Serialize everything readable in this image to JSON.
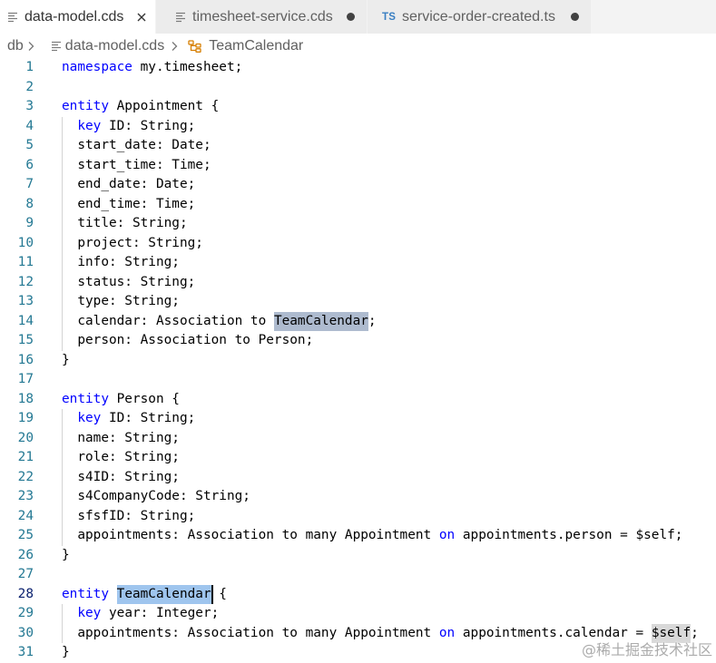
{
  "tabs": [
    {
      "label": "data-model.cds",
      "icon": "cds-file-icon",
      "active": true,
      "action_icon": "close-icon"
    },
    {
      "label": "timesheet-service.cds",
      "icon": "cds-file-icon",
      "modified": true,
      "action_icon": "modified-dot-icon"
    },
    {
      "label": "service-order-created.ts",
      "icon": "typescript-file-icon",
      "badge": "TS",
      "modified": true,
      "action_icon": "modified-dot-icon"
    }
  ],
  "breadcrumb": [
    {
      "label": "db"
    },
    {
      "label": "data-model.cds",
      "icon": "cds-file-icon"
    },
    {
      "label": "TeamCalendar",
      "icon": "symbol-class-icon"
    }
  ],
  "breadcrumb_separator_icon": "chevron-right-icon",
  "colors": {
    "keyword": "#0000ff",
    "text": "#000000",
    "line_number": "#237893",
    "active_line_number": "#0b216f",
    "selection": "#9fc5ee",
    "word_highlight": "#aebbcf",
    "match_highlight": "#d9d9d9",
    "ts_badge": "#3a7fc2",
    "symbol_icon": "#d67e00"
  },
  "editor": {
    "active_line": "28",
    "lines": [
      {
        "n": "1",
        "tokens": [
          {
            "text": "namespace",
            "type": "keyword"
          },
          {
            "text": " my.timesheet;"
          }
        ]
      },
      {
        "n": "2",
        "tokens": []
      },
      {
        "n": "3",
        "tokens": [
          {
            "text": "entity",
            "type": "keyword"
          },
          {
            "text": " Appointment {"
          }
        ]
      },
      {
        "n": "4",
        "tokens": [
          {
            "text": "  ",
            "type": "indent"
          },
          {
            "text": "key",
            "type": "keyword"
          },
          {
            "text": " ID: String;"
          }
        ]
      },
      {
        "n": "5",
        "tokens": [
          {
            "text": "  ",
            "type": "indent"
          },
          {
            "text": "start_date: Date;"
          }
        ]
      },
      {
        "n": "6",
        "tokens": [
          {
            "text": "  ",
            "type": "indent"
          },
          {
            "text": "start_time: Time;"
          }
        ]
      },
      {
        "n": "7",
        "tokens": [
          {
            "text": "  ",
            "type": "indent"
          },
          {
            "text": "end_date: Date;"
          }
        ]
      },
      {
        "n": "8",
        "tokens": [
          {
            "text": "  ",
            "type": "indent"
          },
          {
            "text": "end_time: Time;"
          }
        ]
      },
      {
        "n": "9",
        "tokens": [
          {
            "text": "  ",
            "type": "indent"
          },
          {
            "text": "title: String;"
          }
        ]
      },
      {
        "n": "10",
        "tokens": [
          {
            "text": "  ",
            "type": "indent"
          },
          {
            "text": "project: String;"
          }
        ]
      },
      {
        "n": "11",
        "tokens": [
          {
            "text": "  ",
            "type": "indent"
          },
          {
            "text": "info: String;"
          }
        ]
      },
      {
        "n": "12",
        "tokens": [
          {
            "text": "  ",
            "type": "indent"
          },
          {
            "text": "status: String;"
          }
        ]
      },
      {
        "n": "13",
        "tokens": [
          {
            "text": "  ",
            "type": "indent"
          },
          {
            "text": "type: String;"
          }
        ]
      },
      {
        "n": "14",
        "tokens": [
          {
            "text": "  ",
            "type": "indent"
          },
          {
            "text": "calendar: Association to "
          },
          {
            "text": "TeamCalendar",
            "highlight": "occurrence"
          },
          {
            "text": ";"
          }
        ]
      },
      {
        "n": "15",
        "tokens": [
          {
            "text": "  ",
            "type": "indent"
          },
          {
            "text": "person: Association to Person;"
          }
        ]
      },
      {
        "n": "16",
        "tokens": [
          {
            "text": "}"
          }
        ]
      },
      {
        "n": "17",
        "tokens": []
      },
      {
        "n": "18",
        "tokens": [
          {
            "text": "entity",
            "type": "keyword"
          },
          {
            "text": " Person {"
          }
        ]
      },
      {
        "n": "19",
        "tokens": [
          {
            "text": "  ",
            "type": "indent"
          },
          {
            "text": "key",
            "type": "keyword"
          },
          {
            "text": " ID: String;"
          }
        ]
      },
      {
        "n": "20",
        "tokens": [
          {
            "text": "  ",
            "type": "indent"
          },
          {
            "text": "name: String;"
          }
        ]
      },
      {
        "n": "21",
        "tokens": [
          {
            "text": "  ",
            "type": "indent"
          },
          {
            "text": "role: String;"
          }
        ]
      },
      {
        "n": "22",
        "tokens": [
          {
            "text": "  ",
            "type": "indent"
          },
          {
            "text": "s4ID: String;"
          }
        ]
      },
      {
        "n": "23",
        "tokens": [
          {
            "text": "  ",
            "type": "indent"
          },
          {
            "text": "s4CompanyCode: String;"
          }
        ]
      },
      {
        "n": "24",
        "tokens": [
          {
            "text": "  ",
            "type": "indent"
          },
          {
            "text": "sfsfID: String;"
          }
        ]
      },
      {
        "n": "25",
        "tokens": [
          {
            "text": "  ",
            "type": "indent"
          },
          {
            "text": "appointments: Association to many Appointment "
          },
          {
            "text": "on",
            "type": "keyword"
          },
          {
            "text": " appointments.person = $self;"
          }
        ]
      },
      {
        "n": "26",
        "tokens": [
          {
            "text": "}"
          }
        ]
      },
      {
        "n": "27",
        "tokens": []
      },
      {
        "n": "28",
        "tokens": [
          {
            "text": "entity",
            "type": "keyword"
          },
          {
            "text": " "
          },
          {
            "text": "TeamCalendar",
            "highlight": "selection",
            "caret_after": true
          },
          {
            "text": " {"
          }
        ]
      },
      {
        "n": "29",
        "tokens": [
          {
            "text": "  ",
            "type": "indent"
          },
          {
            "text": "key",
            "type": "keyword"
          },
          {
            "text": " year: Integer;"
          }
        ]
      },
      {
        "n": "30",
        "tokens": [
          {
            "text": "  ",
            "type": "indent"
          },
          {
            "text": "appointments: Association to many Appointment "
          },
          {
            "text": "on",
            "type": "keyword"
          },
          {
            "text": " appointments.calendar = "
          },
          {
            "text": "$self",
            "highlight": "match"
          },
          {
            "text": ";"
          }
        ]
      },
      {
        "n": "31",
        "tokens": [
          {
            "text": "}"
          }
        ]
      }
    ]
  },
  "watermark": {
    "text": "@稀土掘金技术社区"
  }
}
